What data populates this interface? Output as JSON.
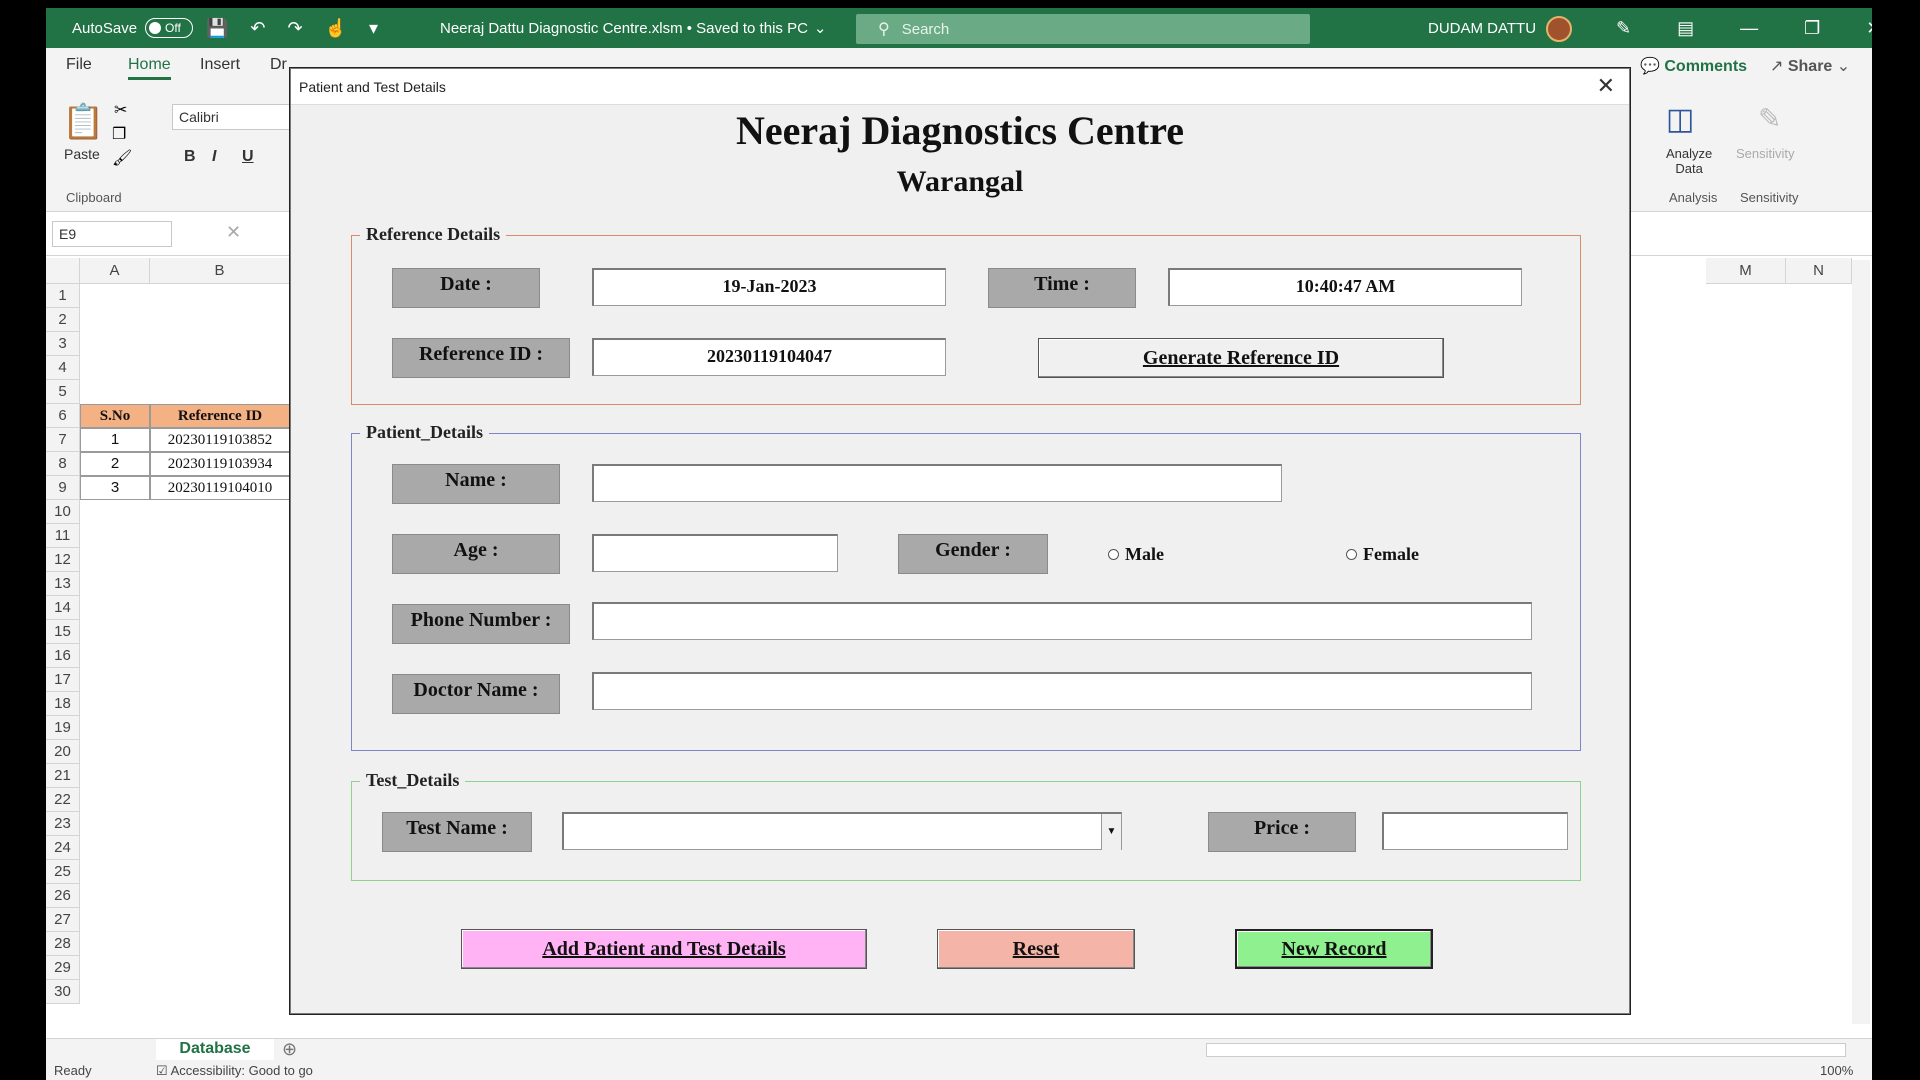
{
  "titlebar": {
    "autosave_label": "AutoSave",
    "autosave_state": "Off",
    "file_title": "Neeraj Dattu Diagnostic Centre.xlsm • Saved to this PC",
    "search_placeholder": "Search",
    "user_name": "DUDAM DATTU"
  },
  "ribbon": {
    "tabs": [
      "File",
      "Home",
      "Insert",
      "Dr"
    ],
    "active_tab": "Home",
    "comments_label": "Comments",
    "share_label": "Share",
    "paste_label": "Paste",
    "clipboard_group": "Clipboard",
    "font_name": "Calibri",
    "bold": "B",
    "italic": "I",
    "underline": "U",
    "analyze_data_line1": "Analyze",
    "analyze_data_line2": "Data",
    "sensitivity_label": "Sensitivity",
    "analysis_group": "Analysis",
    "sensitivity_group": "Sensitivity"
  },
  "formula_bar": {
    "name_box": "E9"
  },
  "grid": {
    "columns_left": [
      "A",
      "B"
    ],
    "columns_right": [
      "M",
      "N"
    ],
    "rows": [
      "1",
      "2",
      "3",
      "4",
      "5",
      "6",
      "7",
      "8",
      "9",
      "10",
      "11",
      "12",
      "13",
      "14",
      "15",
      "16",
      "17",
      "18",
      "19",
      "20",
      "21",
      "22",
      "23",
      "24",
      "25",
      "26",
      "27",
      "28",
      "29",
      "30"
    ],
    "table_headers": [
      "S.No",
      "Reference ID"
    ],
    "table_rows": [
      [
        "1",
        "20230119103852"
      ],
      [
        "2",
        "20230119103934"
      ],
      [
        "3",
        "20230119104010"
      ]
    ]
  },
  "sheet": {
    "active_tab": "Database"
  },
  "status": {
    "ready": "Ready",
    "accessibility": "Accessibility: Good to go",
    "zoom": "100%"
  },
  "dialog": {
    "title": "Patient and Test Details",
    "heading": "Neeraj Diagnostics Centre",
    "subheading": "Warangal",
    "reference_frame": {
      "legend": "Reference Details",
      "date_label": "Date :",
      "date_value": "19-Jan-2023",
      "time_label": "Time :",
      "time_value": "10:40:47 AM",
      "refid_label": "Reference ID :",
      "refid_value": "20230119104047",
      "generate_button": "Generate Reference ID"
    },
    "patient_frame": {
      "legend": "Patient_Details",
      "name_label": "Name :",
      "name_value": "",
      "age_label": "Age :",
      "age_value": "",
      "gender_label": "Gender :",
      "gender_options": [
        "Male",
        "Female"
      ],
      "phone_label": "Phone Number :",
      "phone_value": "",
      "doctor_label": "Doctor Name :",
      "doctor_value": ""
    },
    "test_frame": {
      "legend": "Test_Details",
      "test_label": "Test Name :",
      "test_value": "",
      "price_label": "Price :",
      "price_value": ""
    },
    "buttons": {
      "add": "Add Patient and Test Details",
      "reset": "Reset",
      "new_record": "New Record"
    },
    "colors": {
      "add_button": "#ffb3f5",
      "reset_button": "#f4b4a8",
      "new_record_button": "#8ef08e",
      "reference_border": "#d98c6a",
      "patient_border": "#7e86c9",
      "test_border": "#8fd18f"
    }
  }
}
